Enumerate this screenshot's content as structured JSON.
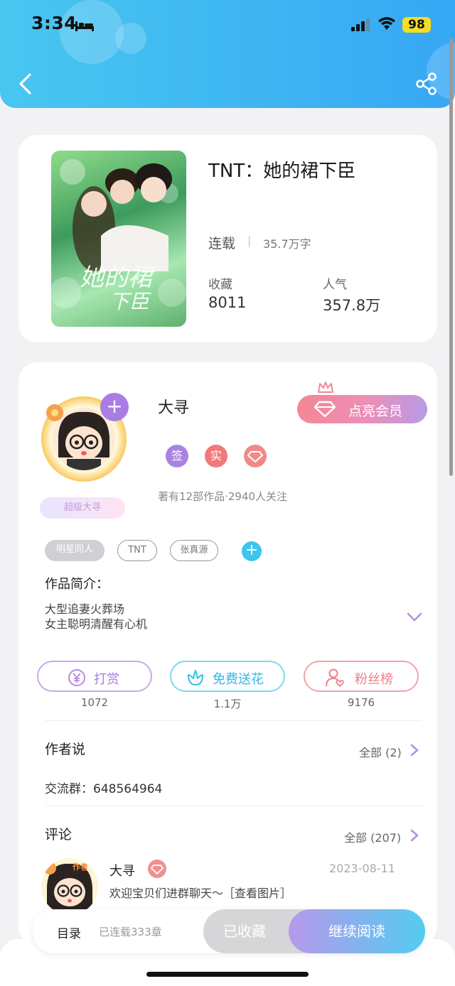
{
  "status_bar": {
    "time": "3:34",
    "battery": "98"
  },
  "book": {
    "title": "TNT：她的裙下臣",
    "status": "连载",
    "word_count": "35.7万字",
    "favorites_label": "收藏",
    "favorites_value": "8011",
    "popularity_label": "人气",
    "popularity_value": "357.8万"
  },
  "author": {
    "name": "大寻",
    "level_badge": "超级大寻",
    "vip_label": "点亮会员",
    "badges": [
      "签",
      "实"
    ],
    "meta": "著有12部作品·2940人关注",
    "tags": [
      "明星同人",
      "TNT",
      "张真源"
    ]
  },
  "intro": {
    "title": "作品简介：",
    "lines": [
      "大型追妻火葬场",
      "女主聪明清醒有心机"
    ]
  },
  "actions": [
    {
      "label": "打赏",
      "count": "1072"
    },
    {
      "label": "免费送花",
      "count": "1.1万"
    },
    {
      "label": "粉丝榜",
      "count": "9176"
    }
  ],
  "author_says": {
    "title": "作者说",
    "more": "全部 (2)",
    "content": "交流群：648564964"
  },
  "comments": {
    "title": "评论",
    "more": "全部 (207)",
    "first": {
      "name": "大寻",
      "date": "2023-08-11",
      "text": "欢迎宝贝们进群聊天～［查看图片］",
      "avatar_tag": "作者"
    }
  },
  "bottom_bar": {
    "toc": "目录",
    "chapters": "已连载333章",
    "collected": "已收藏",
    "continue": "继续阅读"
  },
  "colors": {
    "header": "#3fb6f2",
    "vip": "#f48793",
    "purple": "#a97de4",
    "cyan": "#3cc5ef",
    "red": "#f07f85"
  }
}
